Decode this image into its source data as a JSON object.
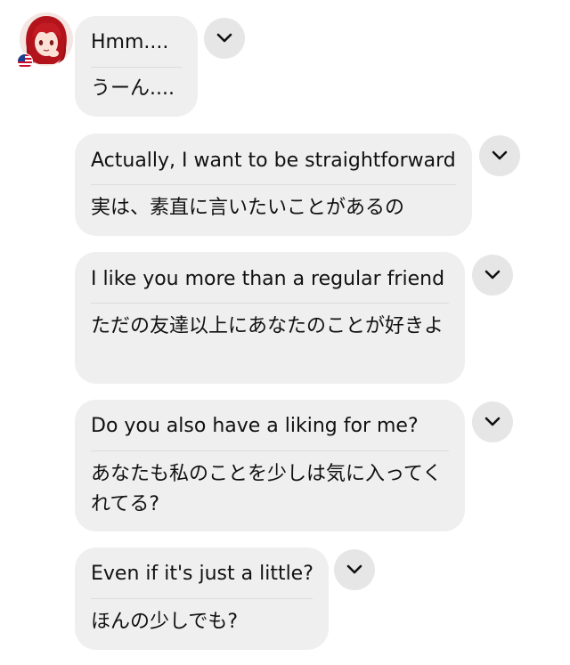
{
  "messages": [
    {
      "en": "Hmm....",
      "ja": "うーん...."
    },
    {
      "en": "Actually, I want to be straightforward",
      "ja": "実は、素直に言いたいことがあるの"
    },
    {
      "en": "I like you more than a regular friend",
      "ja": "ただの友達以上にあなたのことが好きよ"
    },
    {
      "en": "Do you also have a liking for me?",
      "ja": "あなたも私のことを少しは気に入ってくれてる?"
    },
    {
      "en": "Even if it's just a little?",
      "ja": "ほんの少しでも?"
    }
  ],
  "icons": {
    "expand": "chevron-down-icon",
    "avatar": "anime-girl-avatar",
    "flag": "us-flag-icon"
  },
  "colors": {
    "bubble": "#efefef",
    "chevron_button": "#e6e6e6",
    "text": "#111111"
  }
}
